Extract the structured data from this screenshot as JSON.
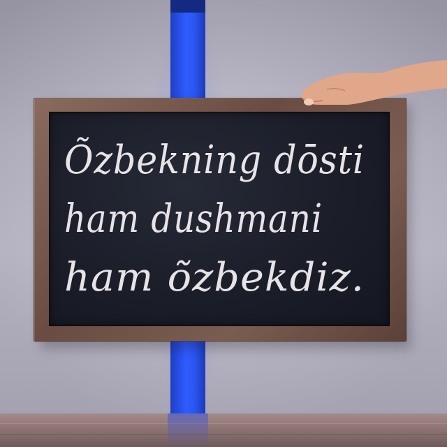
{
  "scene": {
    "colors": {
      "wall": "#bab7c8",
      "light_bar": "#2f5cff",
      "frame": "#6a4c42",
      "chalkboard": "#1b1e29",
      "chalk": "#e7e3e6",
      "table": "#8e7473",
      "skin": "#e0a78b"
    }
  },
  "chalkboard": {
    "lines": [
      "Õzbekning dōsti",
      "ham dushmani",
      "ham õzbekdiz."
    ]
  }
}
